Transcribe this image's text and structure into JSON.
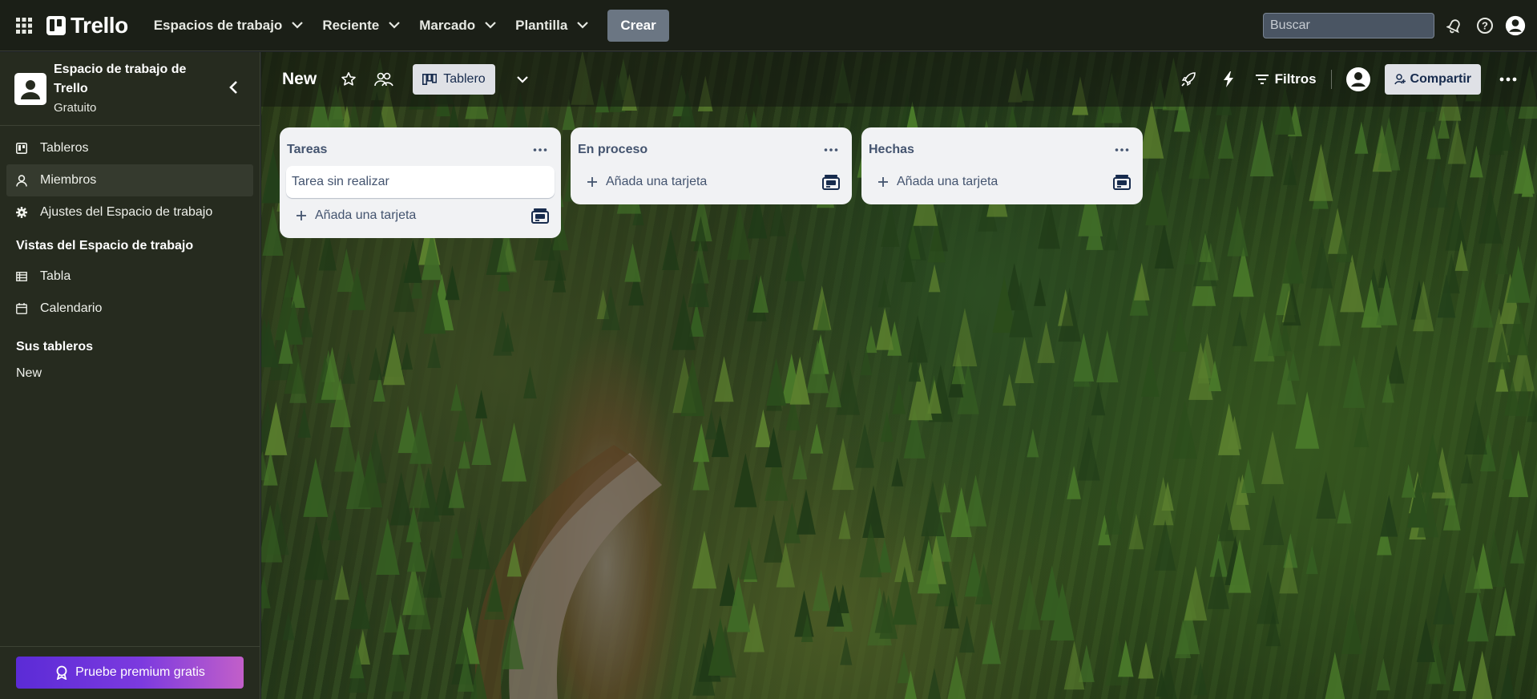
{
  "topnav": {
    "logo_text": "Trello",
    "menus": [
      {
        "label": "Espacios de trabajo"
      },
      {
        "label": "Reciente"
      },
      {
        "label": "Marcado"
      },
      {
        "label": "Plantilla"
      }
    ],
    "create_label": "Crear",
    "search_placeholder": "Buscar"
  },
  "sidebar": {
    "workspace_name": "Espacio de trabajo de Trello",
    "workspace_plan": "Gratuito",
    "items": [
      {
        "label": "Tableros",
        "icon": "board-icon"
      },
      {
        "label": "Miembros",
        "icon": "person-icon"
      },
      {
        "label": "Ajustes del Espacio de trabajo",
        "icon": "gear-icon"
      }
    ],
    "views_title": "Vistas del Espacio de trabajo",
    "views": [
      {
        "label": "Tabla",
        "icon": "table-icon"
      },
      {
        "label": "Calendario",
        "icon": "calendar-icon"
      }
    ],
    "boards_title": "Sus tableros",
    "boards": [
      {
        "label": "New"
      }
    ],
    "premium_label": "Pruebe premium gratis"
  },
  "board": {
    "title": "New",
    "view_label": "Tablero",
    "filters_label": "Filtros",
    "share_label": "Compartir",
    "lists": [
      {
        "title": "Tareas",
        "cards": [
          "Tarea sin realizar"
        ],
        "add_label": "Añada una tarjeta"
      },
      {
        "title": "En proceso",
        "cards": [],
        "add_label": "Añada una tarjeta"
      },
      {
        "title": "Hechas",
        "cards": [],
        "add_label": "Añada una tarjeta"
      }
    ]
  },
  "colors": {
    "topnav_bg": "#1b1f17",
    "sidebar_bg": "#262b1f",
    "list_bg": "#f1f2f4",
    "premium_gradient": [
      "#5b2bd6",
      "#c25fc9"
    ]
  }
}
